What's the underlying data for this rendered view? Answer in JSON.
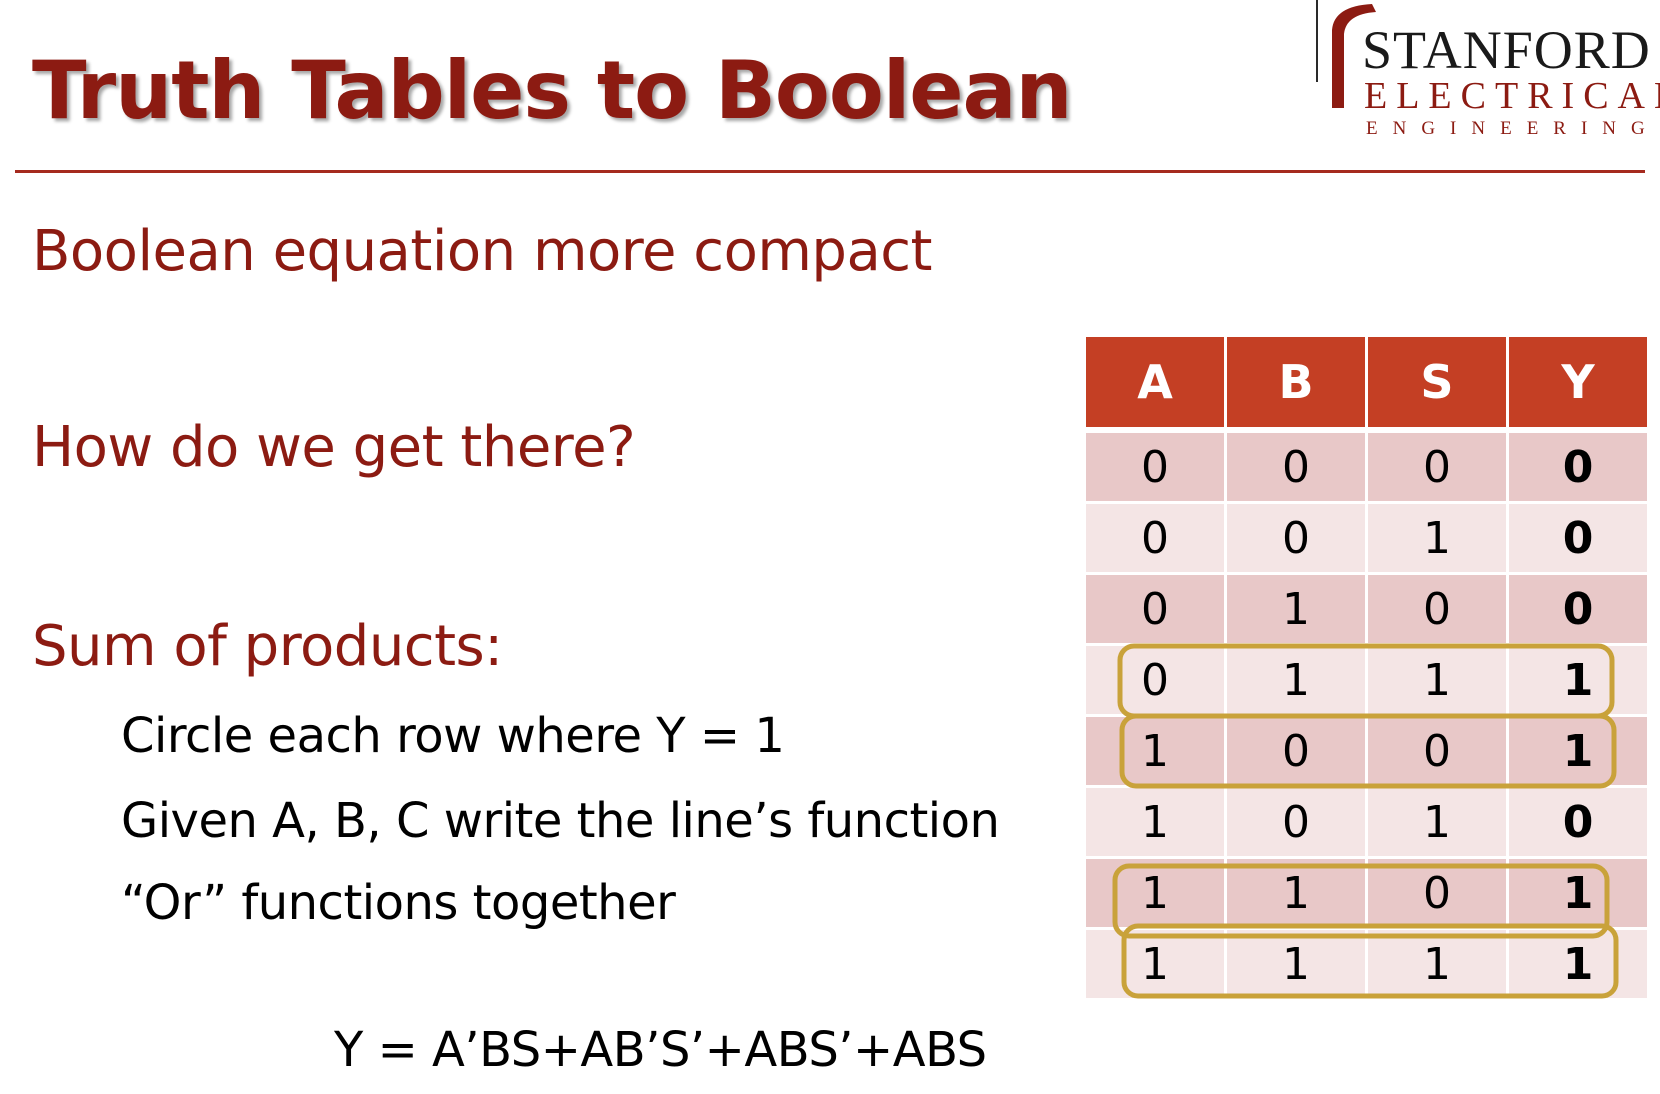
{
  "title": "Truth Tables to Boolean",
  "logo": {
    "line1": "STANFORD",
    "line2": "ELECTRICAL",
    "line3": "ENGINEERING",
    "accent_color": "#8c1b12"
  },
  "points": {
    "compact": "Boolean equation more compact",
    "how": "How do we get there?",
    "sop": "Sum of products:"
  },
  "steps": [
    "Circle each row where Y = 1",
    "Given A, B, C write the line’s function",
    "“Or” functions together"
  ],
  "equation": "Y = A’BS+AB’S’+ABS’+ABS",
  "table": {
    "headers": [
      "A",
      "B",
      "S",
      "Y"
    ],
    "rows": [
      [
        "0",
        "0",
        "0",
        "0"
      ],
      [
        "0",
        "0",
        "1",
        "0"
      ],
      [
        "0",
        "1",
        "0",
        "0"
      ],
      [
        "0",
        "1",
        "1",
        "1"
      ],
      [
        "1",
        "0",
        "0",
        "1"
      ],
      [
        "1",
        "0",
        "1",
        "0"
      ],
      [
        "1",
        "1",
        "0",
        "1"
      ],
      [
        "1",
        "1",
        "1",
        "1"
      ]
    ],
    "circled_rows": [
      3,
      4,
      6,
      7
    ],
    "header_color": "#c43f24",
    "circle_color": "#c9a23a"
  }
}
